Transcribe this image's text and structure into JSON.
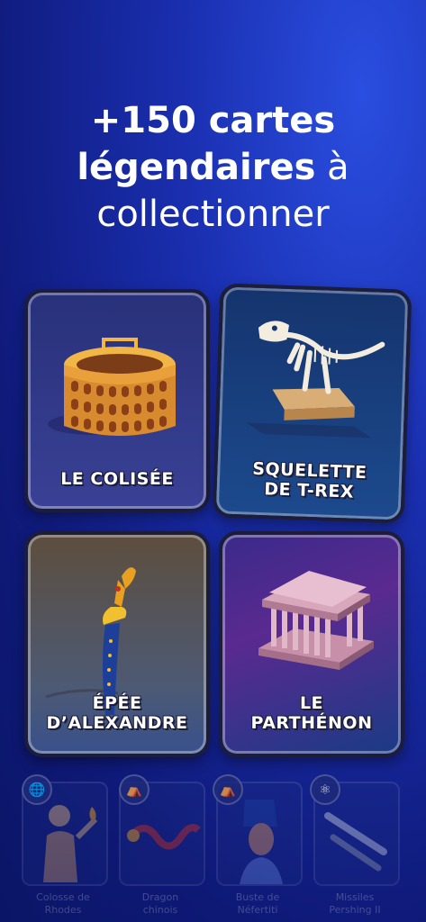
{
  "headline": {
    "line1": "+150 cartes",
    "line2_bold": "légendaires",
    "line2_rest": " à",
    "line3": "collectionner"
  },
  "cards": [
    {
      "label_line1": "LE COLISÉE",
      "label_line2": ""
    },
    {
      "label_line1": "SQUELETTE",
      "label_line2": "DE T-REX"
    },
    {
      "label_line1": "ÉPÉE",
      "label_line2": "D’ALEXANDRE"
    },
    {
      "label_line1": "LE",
      "label_line2": "PARTHÉNON"
    }
  ],
  "mini_cards": [
    {
      "label_line1": "Colosse de",
      "label_line2": "Rhodes",
      "badge_icon": "globe-icon"
    },
    {
      "label_line1": "Dragon",
      "label_line2": "chinois",
      "badge_icon": "museum-icon"
    },
    {
      "label_line1": "Buste de",
      "label_line2": "Néfertiti",
      "badge_icon": "museum-icon"
    },
    {
      "label_line1": "Missiles",
      "label_line2": "Pershing II",
      "badge_icon": "atom-icon"
    }
  ],
  "colors": {
    "background": "#0f1a7a",
    "card_border": "#1b1d3a",
    "text": "#ffffff"
  }
}
